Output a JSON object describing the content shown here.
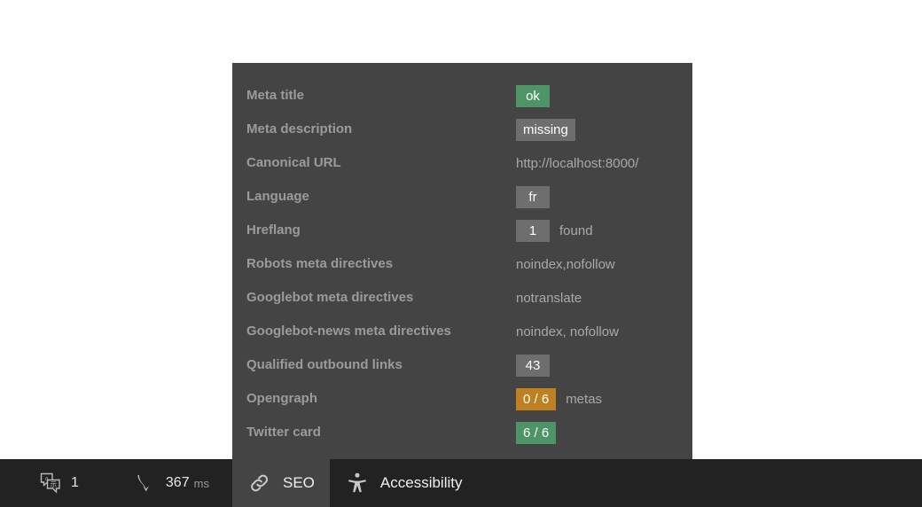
{
  "panel": {
    "name": "seo-report-panel",
    "rows": [
      {
        "label": "Meta title",
        "value": "ok",
        "value_kind": "badge",
        "badge_color": "good",
        "suffix": ""
      },
      {
        "label": "Meta description",
        "value": "missing",
        "value_kind": "badge",
        "badge_color": "neutral",
        "suffix": ""
      },
      {
        "label": "Canonical URL",
        "value": "http://localhost:8000/",
        "value_kind": "text",
        "badge_color": "",
        "suffix": ""
      },
      {
        "label": "Language",
        "value": "fr",
        "value_kind": "badge",
        "badge_color": "neutral",
        "suffix": ""
      },
      {
        "label": "Hreflang",
        "value": "1",
        "value_kind": "badge",
        "badge_color": "neutral",
        "suffix": "found"
      },
      {
        "label": "Robots meta directives",
        "value": "noindex,nofollow",
        "value_kind": "text",
        "badge_color": "",
        "suffix": ""
      },
      {
        "label": "Googlebot meta directives",
        "value": "notranslate",
        "value_kind": "text",
        "badge_color": "",
        "suffix": ""
      },
      {
        "label": "Googlebot-news meta directives",
        "value": "noindex, nofollow",
        "value_kind": "text",
        "badge_color": "",
        "suffix": ""
      },
      {
        "label": "Qualified outbound links",
        "value": "43",
        "value_kind": "badge",
        "badge_color": "neutral",
        "suffix": ""
      },
      {
        "label": "Opengraph",
        "value": "0 / 6",
        "value_kind": "badge",
        "badge_color": "warn",
        "suffix": "metas"
      },
      {
        "label": "Twitter card",
        "value": "6 / 6",
        "value_kind": "badge",
        "badge_color": "good",
        "suffix": ""
      }
    ]
  },
  "toolbar": {
    "stats": [
      {
        "icon": "translate-icon",
        "value": "1",
        "unit": ""
      },
      {
        "icon": "load-time-icon",
        "value": "367",
        "unit": "ms"
      }
    ],
    "tabs": [
      {
        "icon": "link-icon",
        "label": "SEO",
        "active": true
      },
      {
        "icon": "accessibility-icon",
        "label": "Accessibility",
        "active": false
      }
    ]
  },
  "colors": {
    "panel_background": "#444444",
    "toolbar_background": "#222222",
    "badge_good": "#4d9467",
    "badge_warn": "#bf8020",
    "badge_neutral": "#6e6e6e",
    "label_text": "#9b9b9b",
    "value_text": "#a9a9a9"
  }
}
